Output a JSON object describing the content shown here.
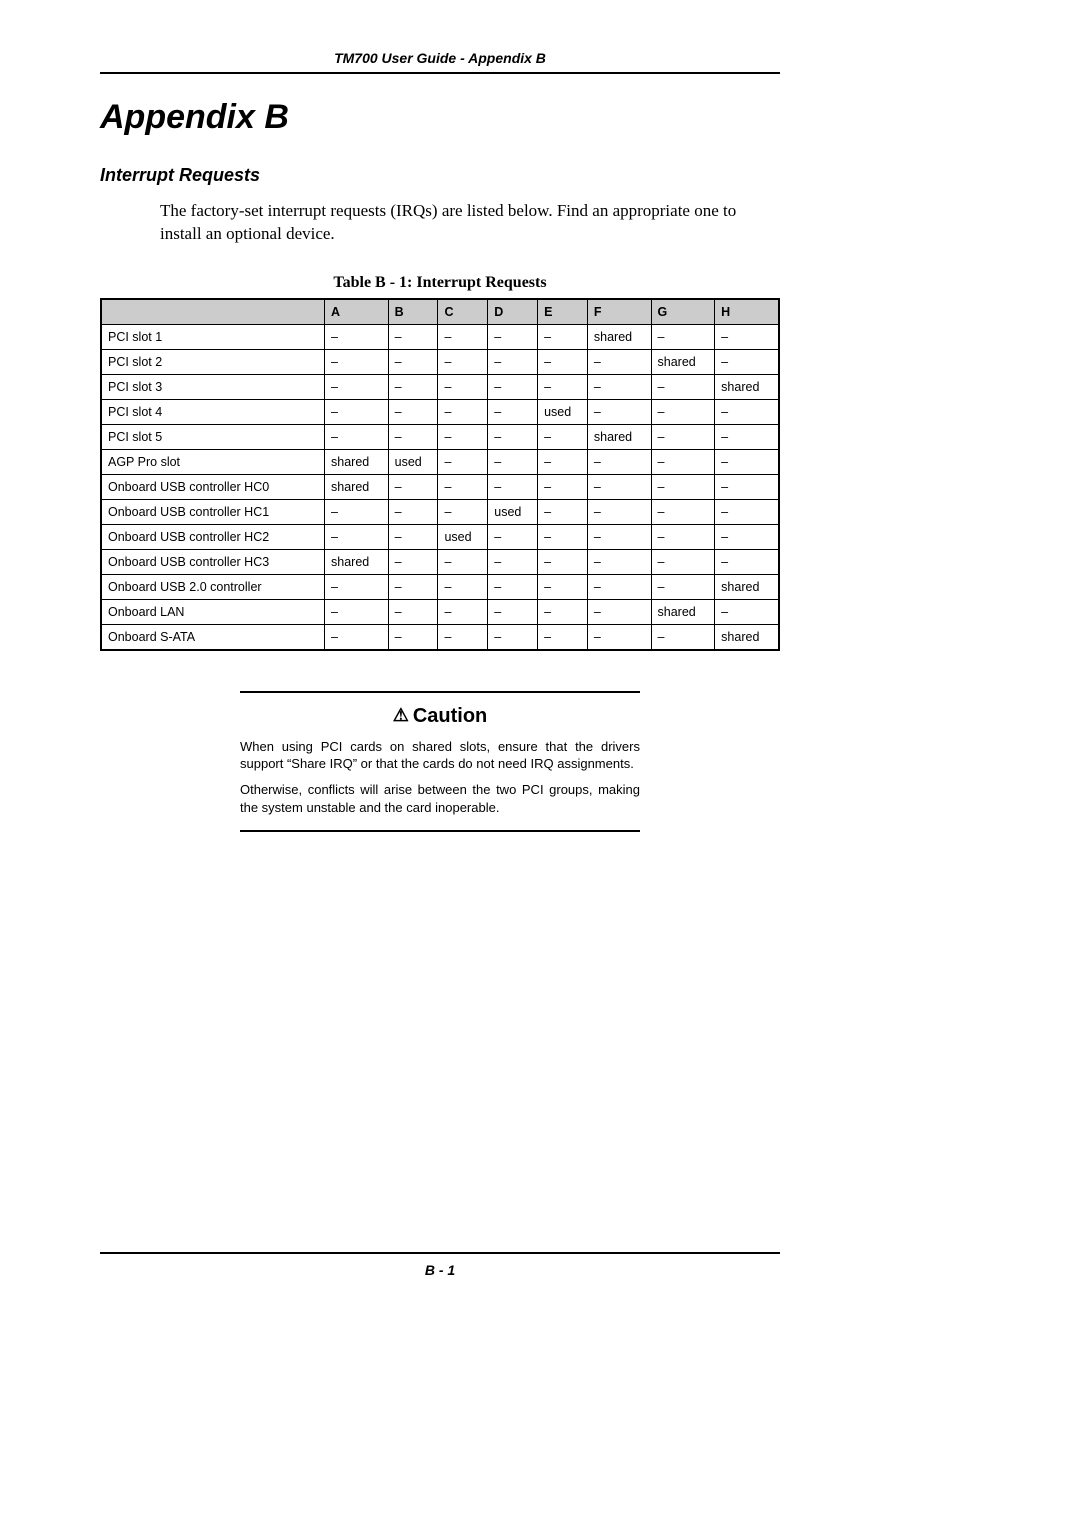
{
  "header": {
    "running_head": "TM700 User Guide - Appendix B"
  },
  "title": "Appendix B",
  "section_title": "Interrupt Requests",
  "intro": "The factory-set interrupt requests (IRQs) are listed below. Find an appropriate one to install an optional device.",
  "table": {
    "caption": "Table B - 1: Interrupt Requests",
    "columns": [
      "",
      "A",
      "B",
      "C",
      "D",
      "E",
      "F",
      "G",
      "H"
    ],
    "rows": [
      {
        "label": "PCI slot 1",
        "cells": [
          "–",
          "–",
          "–",
          "–",
          "–",
          "shared",
          "–",
          "–"
        ]
      },
      {
        "label": "PCI slot 2",
        "cells": [
          "–",
          "–",
          "–",
          "–",
          "–",
          "–",
          "shared",
          "–"
        ]
      },
      {
        "label": "PCI slot 3",
        "cells": [
          "–",
          "–",
          "–",
          "–",
          "–",
          "–",
          "–",
          "shared"
        ]
      },
      {
        "label": "PCI slot 4",
        "cells": [
          "–",
          "–",
          "–",
          "–",
          "used",
          "–",
          "–",
          "–"
        ]
      },
      {
        "label": "PCI slot 5",
        "cells": [
          "–",
          "–",
          "–",
          "–",
          "–",
          "shared",
          "–",
          "–"
        ]
      },
      {
        "label": "AGP Pro slot",
        "cells": [
          "shared",
          "used",
          "–",
          "–",
          "–",
          "–",
          "–",
          "–"
        ]
      },
      {
        "label": "Onboard USB controller HC0",
        "cells": [
          "shared",
          "–",
          "–",
          "–",
          "–",
          "–",
          "–",
          "–"
        ]
      },
      {
        "label": "Onboard USB controller HC1",
        "cells": [
          "–",
          "–",
          "–",
          "used",
          "–",
          "–",
          "–",
          "–"
        ]
      },
      {
        "label": "Onboard USB controller HC2",
        "cells": [
          "–",
          "–",
          "used",
          "–",
          "–",
          "–",
          "–",
          "–"
        ]
      },
      {
        "label": "Onboard USB controller HC3",
        "cells": [
          "shared",
          "–",
          "–",
          "–",
          "–",
          "–",
          "–",
          "–"
        ]
      },
      {
        "label": "Onboard USB 2.0 controller",
        "cells": [
          "–",
          "–",
          "–",
          "–",
          "–",
          "–",
          "–",
          "shared"
        ]
      },
      {
        "label": "Onboard LAN",
        "cells": [
          "–",
          "–",
          "–",
          "–",
          "–",
          "–",
          "shared",
          "–"
        ]
      },
      {
        "label": "Onboard S-ATA",
        "cells": [
          "–",
          "–",
          "–",
          "–",
          "–",
          "–",
          "–",
          "shared"
        ]
      }
    ]
  },
  "caution": {
    "title": "Caution",
    "para1": "When using PCI cards on shared slots, ensure that the drivers support “Share IRQ” or that the cards do not need IRQ assignments.",
    "para2": "Otherwise, conflicts will arise between the two PCI groups, making the system unstable and the card inoperable."
  },
  "footer": {
    "page_label": "B - 1"
  }
}
